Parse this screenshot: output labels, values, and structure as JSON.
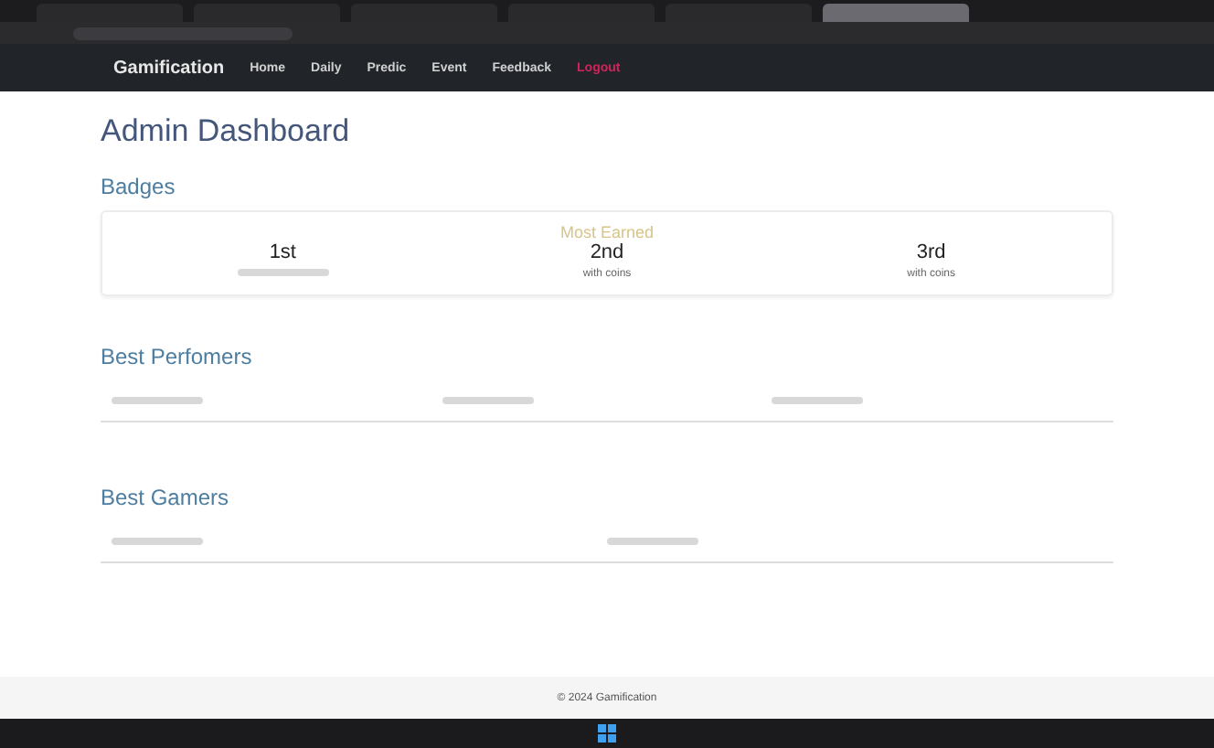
{
  "browser": {
    "tabs": [
      {
        "selected": false
      },
      {
        "selected": false
      },
      {
        "selected": false
      },
      {
        "selected": false
      },
      {
        "selected": false
      },
      {
        "selected": true
      }
    ]
  },
  "navbar": {
    "brand": "Gamification",
    "links": [
      {
        "label": "Home",
        "kind": "link"
      },
      {
        "label": "Daily",
        "kind": "link"
      },
      {
        "label": "Predic",
        "kind": "link"
      },
      {
        "label": "Event",
        "kind": "link"
      },
      {
        "label": "Feedback",
        "kind": "link"
      },
      {
        "label": "Logout",
        "kind": "logout"
      }
    ]
  },
  "page": {
    "title": "Admin Dashboard"
  },
  "badges": {
    "heading": "Badges",
    "caption": "Most Earned",
    "places": [
      {
        "rank": "1st"
      },
      {
        "rank": "2nd",
        "note": "with coins"
      },
      {
        "rank": "3rd",
        "note": "with coins"
      }
    ]
  },
  "best_performers": {
    "heading": "Best Perfomers"
  },
  "best_gamers": {
    "heading": "Best Gamers"
  },
  "footer": {
    "text": "© 2024 Gamification"
  }
}
